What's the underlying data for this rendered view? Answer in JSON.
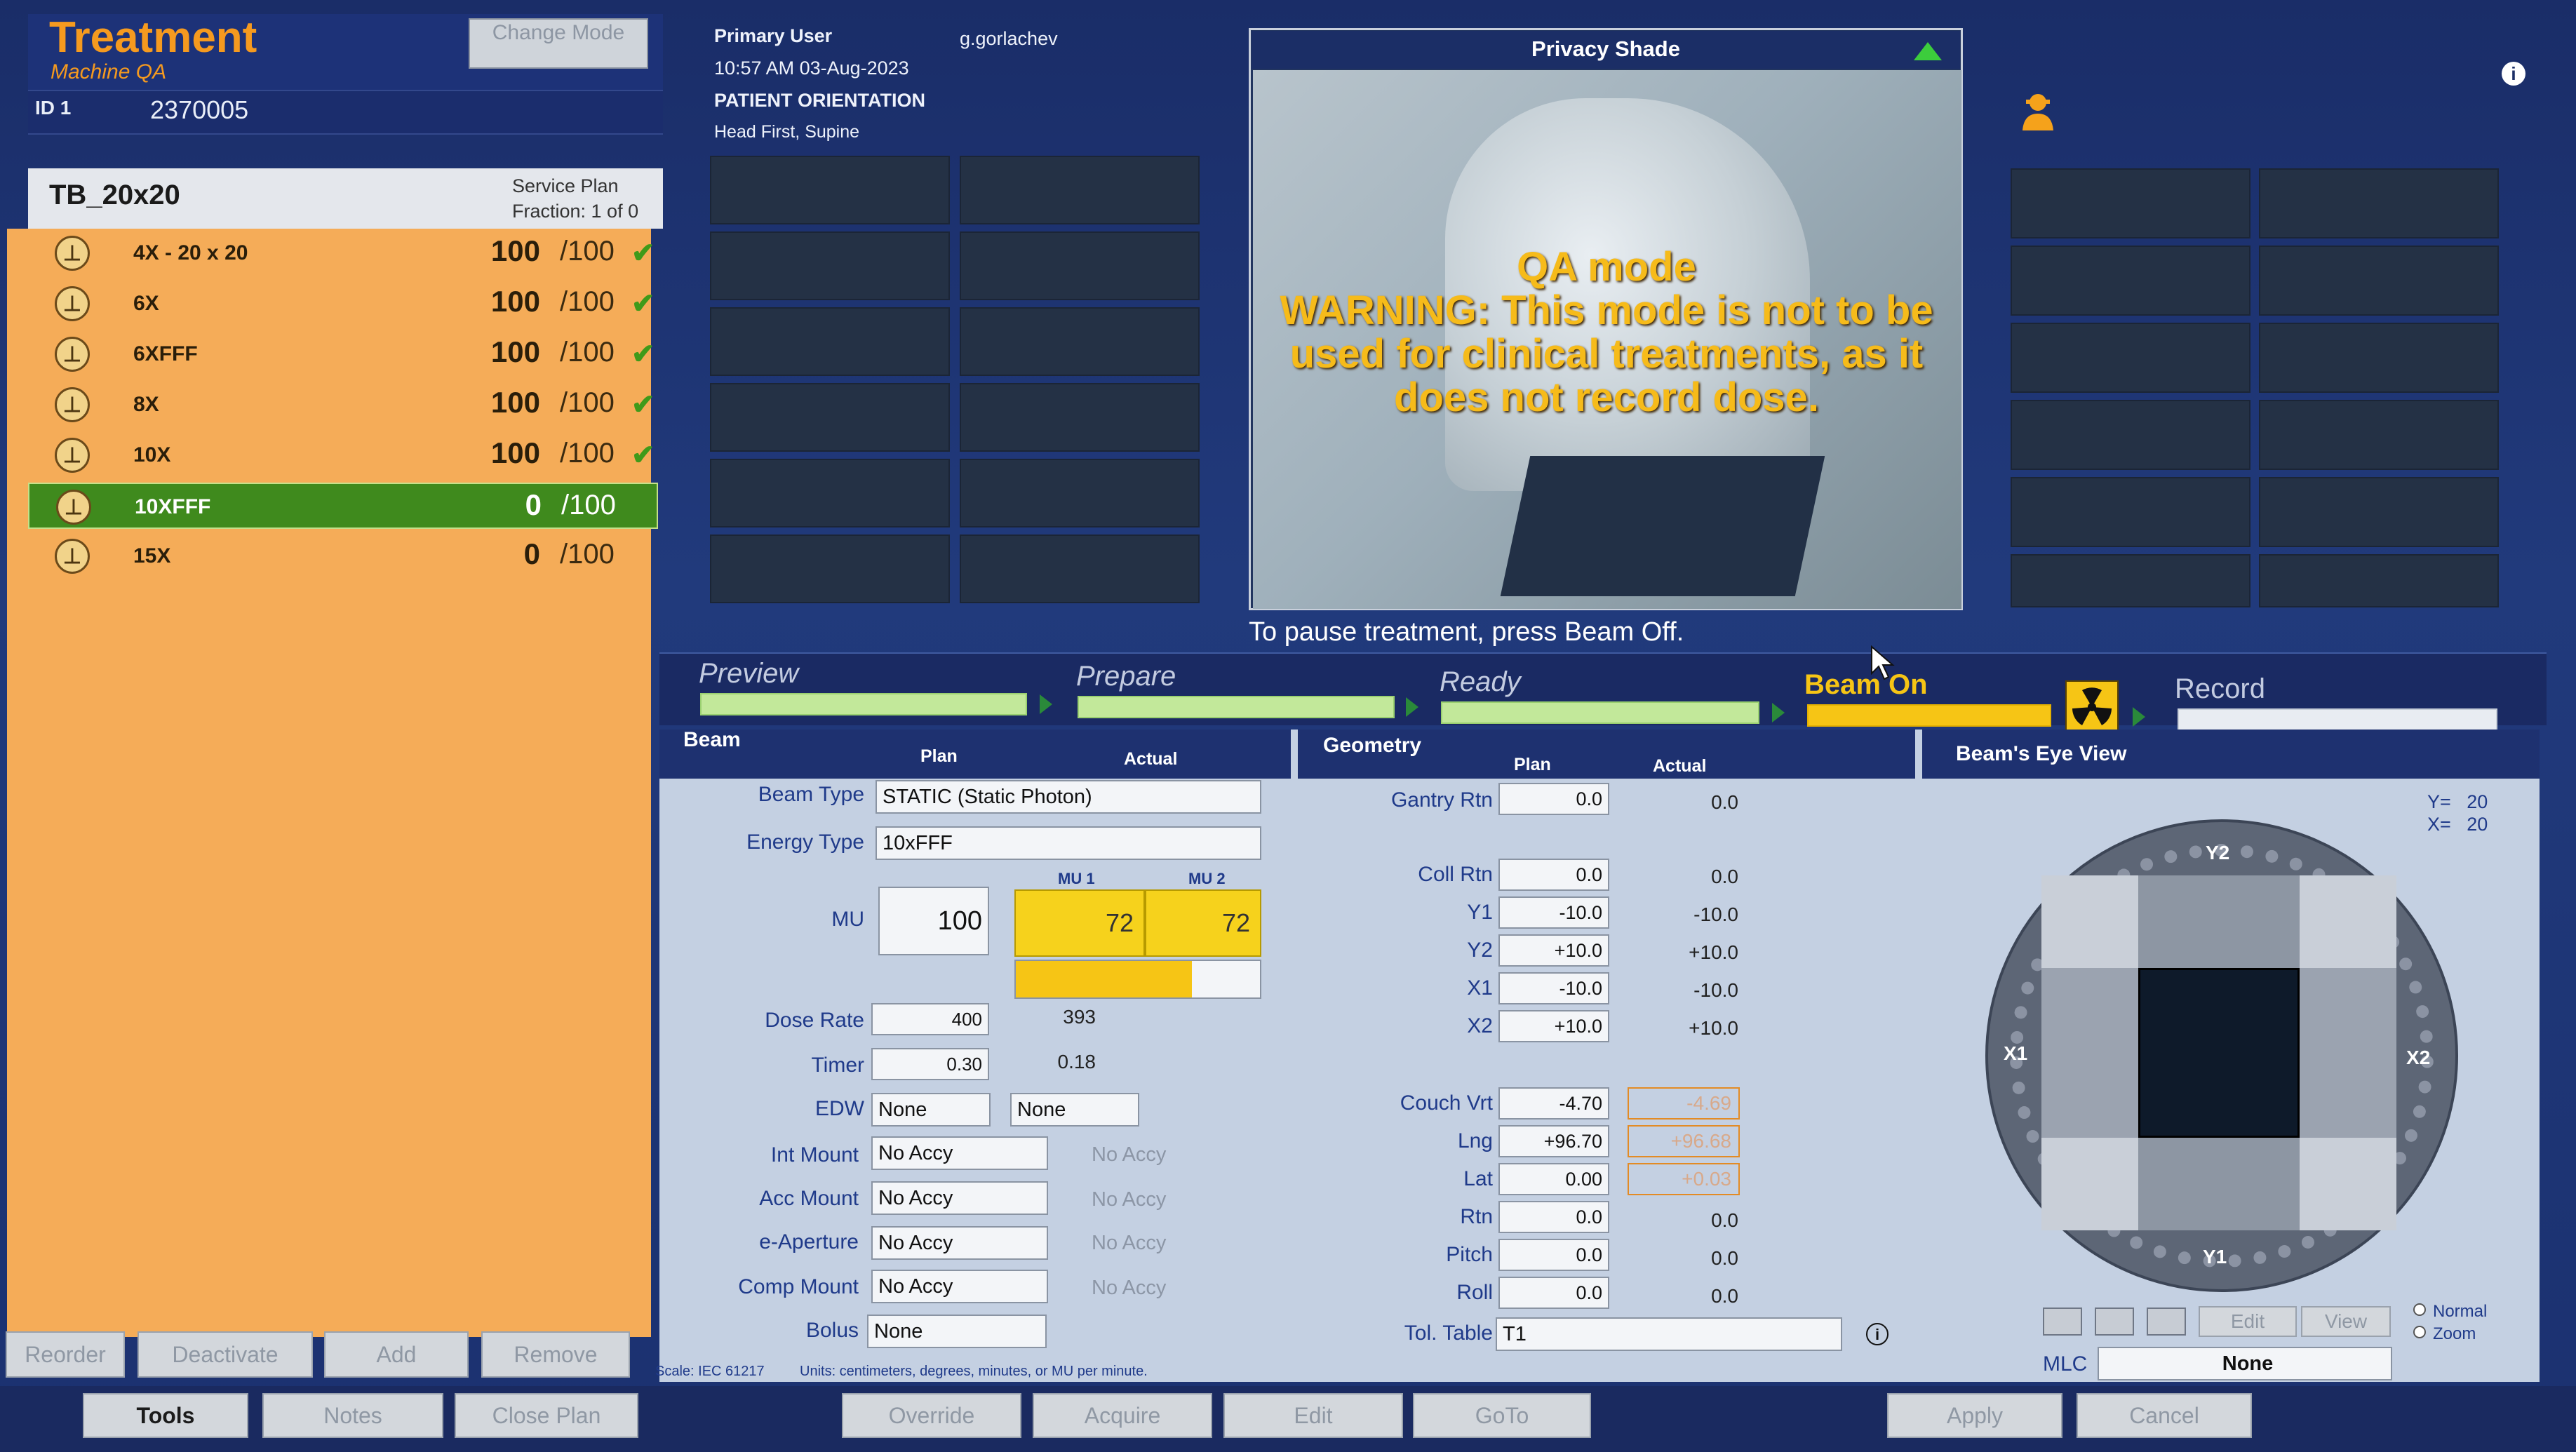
{
  "header": {
    "title": "Treatment",
    "subtitle": "Machine QA",
    "change_mode": "Change Mode",
    "id_label": "ID 1",
    "id_value": "2370005"
  },
  "plan": {
    "name": "TB_20x20",
    "service_plan": "Service Plan",
    "fraction": "Fraction:  1 of 0"
  },
  "fields": [
    {
      "name": "4X - 20 x 20",
      "mu": "100",
      "max": "/100",
      "done": true
    },
    {
      "name": "6X",
      "mu": "100",
      "max": "/100",
      "done": true
    },
    {
      "name": "6XFFF",
      "mu": "100",
      "max": "/100",
      "done": true
    },
    {
      "name": "8X",
      "mu": "100",
      "max": "/100",
      "done": true
    },
    {
      "name": "10X",
      "mu": "100",
      "max": "/100",
      "done": true
    },
    {
      "name": "10XFFF",
      "mu": "0",
      "max": "/100",
      "done": false,
      "selected": true
    },
    {
      "name": "15X",
      "mu": "0",
      "max": "/100",
      "done": false
    }
  ],
  "left_buttons": {
    "reorder": "Reorder",
    "deactivate": "Deactivate",
    "add": "Add",
    "remove": "Remove"
  },
  "bottom_buttons": {
    "tools": "Tools",
    "notes": "Notes",
    "close_plan": "Close Plan",
    "override": "Override",
    "acquire": "Acquire",
    "edit": "Edit",
    "goto": "GoTo",
    "apply": "Apply",
    "cancel": "Cancel"
  },
  "user": {
    "primary_label": "Primary User",
    "primary_value": "g.gorlachev",
    "datetime": "10:57 AM 03-Aug-2023",
    "orientation_label": "PATIENT ORIENTATION",
    "orientation_value": "Head First, Supine"
  },
  "video": {
    "title": "Privacy Shade",
    "warning_1": "QA mode",
    "warning_2": "WARNING: This mode is not to be",
    "warning_3": "used for clinical treatments, as it",
    "warning_4": "does not record dose."
  },
  "pause_text": "To pause treatment, press Beam Off.",
  "stages": [
    {
      "label": "Preview",
      "state": "done"
    },
    {
      "label": "Prepare",
      "state": "done"
    },
    {
      "label": "Ready",
      "state": "done"
    },
    {
      "label": "Beam On",
      "state": "active"
    },
    {
      "label": "Record",
      "state": "pending"
    }
  ],
  "beam": {
    "title": "Beam",
    "plan_col": "Plan",
    "actual_col": "Actual",
    "beam_type_label": "Beam Type",
    "beam_type": "STATIC (Static Photon)",
    "energy_type_label": "Energy Type",
    "energy_type": "10xFFF",
    "mu_label": "MU",
    "mu_plan": "100",
    "mu1_label": "MU 1",
    "mu2_label": "MU 2",
    "mu1": "72",
    "mu2": "72",
    "mu_progress": 0.72,
    "dose_rate_label": "Dose Rate",
    "dose_rate_plan": "400",
    "dose_rate_actual": "393",
    "timer_label": "Timer",
    "timer_plan": "0.30",
    "timer_actual": "0.18",
    "edw_label": "EDW",
    "edw_plan": "None",
    "edw_actual": "None",
    "int_mount_label": "Int Mount",
    "int_mount_plan": "No Accy",
    "int_mount_actual": "No Accy",
    "acc_mount_label": "Acc Mount",
    "acc_mount_plan": "No Accy",
    "acc_mount_actual": "No Accy",
    "eap_label": "e-Aperture",
    "eap_plan": "No Accy",
    "eap_actual": "No Accy",
    "comp_label": "Comp Mount",
    "comp_plan": "No Accy",
    "comp_actual": "No Accy",
    "bolus_label": "Bolus",
    "bolus_plan": "None",
    "scale": "Scale: IEC 61217",
    "units": "Units: centimeters, degrees, minutes, or MU per minute."
  },
  "geometry": {
    "title": "Geometry",
    "plan_col": "Plan",
    "actual_col": "Actual",
    "rows": [
      {
        "label": "Gantry Rtn",
        "plan": "0.0",
        "actual": "0.0"
      },
      {
        "label": "Coll Rtn",
        "plan": "0.0",
        "actual": "0.0"
      },
      {
        "label": "Y1",
        "plan": "-10.0",
        "actual": "-10.0"
      },
      {
        "label": "Y2",
        "plan": "+10.0",
        "actual": "+10.0"
      },
      {
        "label": "X1",
        "plan": "-10.0",
        "actual": "-10.0"
      },
      {
        "label": "X2",
        "plan": "+10.0",
        "actual": "+10.0"
      },
      {
        "label": "Couch Vrt",
        "plan": "-4.70",
        "actual": "-4.69"
      },
      {
        "label": "Lng",
        "plan": "+96.70",
        "actual": "+96.68"
      },
      {
        "label": "Lat",
        "plan": "0.00",
        "actual": "+0.03"
      },
      {
        "label": "Rtn",
        "plan": "0.0",
        "actual": "0.0"
      },
      {
        "label": "Pitch",
        "plan": "0.0",
        "actual": "0.0"
      },
      {
        "label": "Roll",
        "plan": "0.0",
        "actual": "0.0"
      }
    ],
    "tol_label": "Tol. Table",
    "tol_value": "T1"
  },
  "bev": {
    "title": "Beam's Eye View",
    "y_readout": "Y=   20",
    "x_readout": "X=   20",
    "y2": "Y2",
    "y1": "Y1",
    "x1": "X1",
    "x2": "X2",
    "edit": "Edit",
    "view": "View",
    "normal": "Normal",
    "zoom": "Zoom",
    "mlc_label": "MLC",
    "mlc_value": "None"
  },
  "icons": {
    "info": "info-icon",
    "user": "user-icon",
    "radiation": "radiation-icon",
    "check": "check-icon",
    "field": "beam-field-icon"
  },
  "colors": {
    "accent_orange": "#f59a1f",
    "field_list": "#f5ac58",
    "selected": "#3f8a1d",
    "mu_yellow": "#f6d21c",
    "progress_green": "#c2e89a"
  }
}
